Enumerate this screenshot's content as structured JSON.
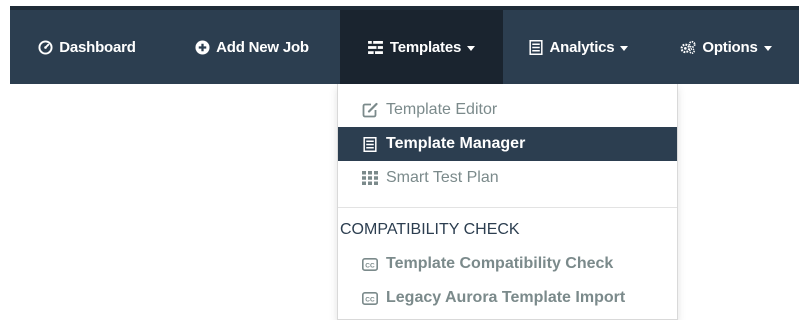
{
  "navbar": {
    "items": [
      {
        "label": "Dashboard",
        "icon": "dashboard-icon"
      },
      {
        "label": "Add New Job",
        "icon": "plus-circle-icon"
      },
      {
        "label": "Templates",
        "icon": "templates-icon",
        "active": true,
        "has_caret": true
      },
      {
        "label": "Analytics",
        "icon": "analytics-icon",
        "has_caret": true
      },
      {
        "label": "Options",
        "icon": "cogs-icon",
        "has_caret": true
      }
    ]
  },
  "templates_menu": {
    "items": [
      {
        "label": "Template Editor",
        "icon": "edit-icon"
      },
      {
        "label": "Template Manager",
        "icon": "list-icon",
        "active": true
      },
      {
        "label": "Smart Test Plan",
        "icon": "grid-icon"
      }
    ],
    "section_header": "COMPATIBILITY CHECK",
    "section_items": [
      {
        "label": "Template Compatibility Check",
        "icon": "cc-icon"
      },
      {
        "label": "Legacy Aurora Template Import",
        "icon": "cc-icon"
      }
    ]
  },
  "colors": {
    "navbar_bg": "#2c3e50",
    "navbar_active_bg": "#1a242f",
    "dropdown_active_bg": "#2c3e50",
    "menu_text": "#7b8a8b"
  }
}
